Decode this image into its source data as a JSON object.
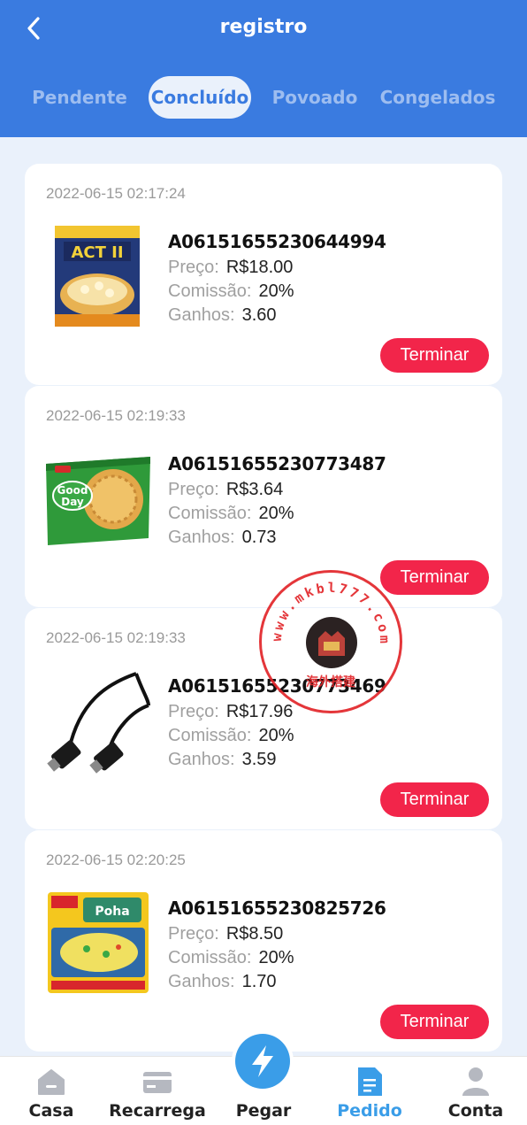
{
  "header": {
    "title": "registro",
    "tabs": [
      "Pendente",
      "Concluído",
      "Povoado",
      "Congelados"
    ],
    "active_tab": "Concluído"
  },
  "labels": {
    "price": "Preço:",
    "commission": "Comissão:",
    "earnings": "Ganhos:",
    "action": "Terminar"
  },
  "orders": [
    {
      "date": "2022-06-15 02:17:24",
      "id": "A06151655230644994",
      "price": "R$18.00",
      "commission": "20%",
      "earnings": "3.60",
      "image": "popcorn-product"
    },
    {
      "date": "2022-06-15 02:19:33",
      "id": "A06151655230773487",
      "price": "R$3.64",
      "commission": "20%",
      "earnings": "0.73",
      "image": "biscuit-product"
    },
    {
      "date": "2022-06-15 02:19:33",
      "id": "A06151655230773469",
      "price": "R$17.96",
      "commission": "20%",
      "earnings": "3.59",
      "image": "hdmi-cable-product"
    },
    {
      "date": "2022-06-15 02:20:25",
      "id": "A06151655230825726",
      "price": "R$8.50",
      "commission": "20%",
      "earnings": "1.70",
      "image": "poha-product"
    }
  ],
  "watermark": {
    "text": "www.mkbl777.com",
    "cjk": "海外搭建",
    "subtext": "mkbl777.com"
  },
  "tabbar": [
    {
      "label": "Casa",
      "icon": "home-icon"
    },
    {
      "label": "Recarrega",
      "icon": "card-icon"
    },
    {
      "label": "Pegar",
      "icon": "lightning-icon"
    },
    {
      "label": "Pedido",
      "icon": "document-icon",
      "active": true
    },
    {
      "label": "Conta",
      "icon": "user-icon"
    }
  ],
  "colors": {
    "primary": "#3a7be0",
    "accent": "#f2254a",
    "tabbar_active": "#3a9de8"
  }
}
